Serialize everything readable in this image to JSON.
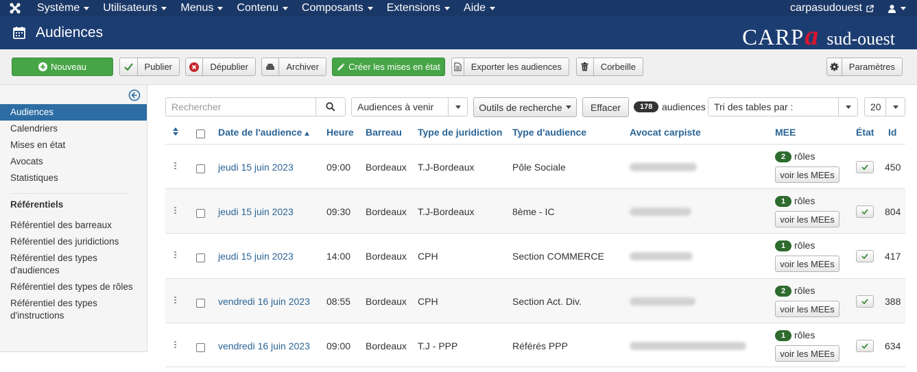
{
  "topnav": {
    "menus": [
      "Système",
      "Utilisateurs",
      "Menus",
      "Contenu",
      "Composants",
      "Extensions",
      "Aide"
    ],
    "site_link": "carpasudouest"
  },
  "header": {
    "title": "Audiences",
    "logo_carp": "CARP",
    "logo_a": "a",
    "logo_region": "sud-ouest"
  },
  "toolbar": {
    "new_label": "Nouveau",
    "publish_label": "Publier",
    "unpublish_label": "Dépublier",
    "archive_label": "Archiver",
    "create_mee_label": "Créer les mises en état",
    "export_label": "Exporter les audiences",
    "trash_label": "Corbeille",
    "options_label": "Paramètres"
  },
  "sidebar": {
    "items": [
      "Audiences",
      "Calendriers",
      "Mises en état",
      "Avocats",
      "Statistiques"
    ],
    "active": "Audiences",
    "ref_heading": "Référentiels",
    "ref_items": [
      "Référentiel des barreaux",
      "Référentiel des juridictions",
      "Référentiel des types",
      "d'audiences",
      "Référentiel des types de rôles",
      "Référentiel des types",
      "d'instructions"
    ]
  },
  "filters": {
    "search_placeholder": "Rechercher",
    "period_value": "Audiences à venir",
    "search_tools_label": "Outils de recherche",
    "clear_label": "Effacer",
    "total_count": "178",
    "count_suffix": "audiences",
    "sort_value": "Tri des tables par :",
    "limit_value": "20"
  },
  "table": {
    "headers": {
      "date": "Date de l'audience",
      "time": "Heure",
      "bar": "Barreau",
      "jurisdiction_type": "Type de juridiction",
      "hearing_type": "Type d'audience",
      "lawyer": "Avocat carpiste",
      "mee": "MEE",
      "state": "État",
      "id": "Id"
    },
    "roles_label": "rôles",
    "mee_button_label": "voir les MEEs",
    "rows": [
      {
        "date": "jeudi 15 juin 2023",
        "time": "09:00",
        "bar": "Bordeaux",
        "jurisdiction": "T.J-Bordeaux",
        "hearing": "Pôle Sociale",
        "roles": "2",
        "id": "450"
      },
      {
        "date": "jeudi 15 juin 2023",
        "time": "09:30",
        "bar": "Bordeaux",
        "jurisdiction": "T.J-Bordeaux",
        "hearing": "8ème - IC",
        "roles": "1",
        "id": "804"
      },
      {
        "date": "jeudi 15 juin 2023",
        "time": "14:00",
        "bar": "Bordeaux",
        "jurisdiction": "CPH",
        "hearing": "Section COMMERCE",
        "roles": "1",
        "id": "417"
      },
      {
        "date": "vendredi 16 juin 2023",
        "time": "08:55",
        "bar": "Bordeaux",
        "jurisdiction": "CPH",
        "hearing": "Section Act. Div.",
        "roles": "2",
        "id": "388"
      },
      {
        "date": "vendredi 16 juin 2023",
        "time": "09:00",
        "bar": "Bordeaux",
        "jurisdiction": "T.J - PPP",
        "hearing": "Référés PPP",
        "roles": "1",
        "id": "634"
      }
    ]
  }
}
